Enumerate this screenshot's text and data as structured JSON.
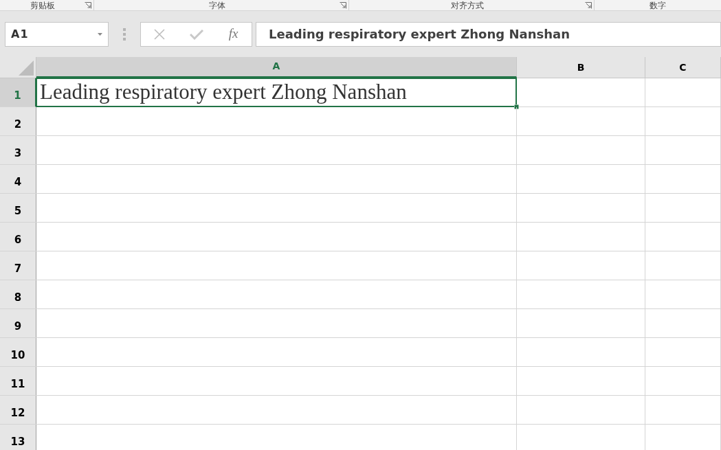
{
  "ribbon_groups": [
    {
      "label": "剪贴板",
      "launcher": true
    },
    {
      "label": "字体",
      "launcher": true
    },
    {
      "label": "对齐方式",
      "launcher": true
    },
    {
      "label": "数字",
      "launcher": false
    }
  ],
  "name_box": {
    "value": "A1"
  },
  "formula_bar": {
    "function_label": "fx",
    "value": "Leading respiratory expert Zhong Nanshan"
  },
  "columns": [
    {
      "label": "A",
      "selected": true
    },
    {
      "label": "B",
      "selected": false
    },
    {
      "label": "C",
      "selected": false
    }
  ],
  "rows": [
    {
      "label": "1",
      "selected": true,
      "cells": [
        {
          "value": "Leading respiratory expert Zhong Nanshan",
          "selected": true
        }
      ]
    },
    {
      "label": "2",
      "selected": false
    },
    {
      "label": "3",
      "selected": false
    },
    {
      "label": "4",
      "selected": false
    },
    {
      "label": "5",
      "selected": false
    },
    {
      "label": "6",
      "selected": false
    },
    {
      "label": "7",
      "selected": false
    },
    {
      "label": "8",
      "selected": false
    },
    {
      "label": "9",
      "selected": false
    },
    {
      "label": "10",
      "selected": false
    },
    {
      "label": "11",
      "selected": false
    },
    {
      "label": "12",
      "selected": false
    },
    {
      "label": "13",
      "selected": false
    }
  ]
}
